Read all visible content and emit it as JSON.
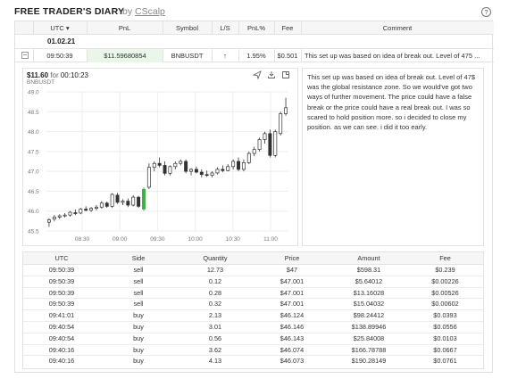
{
  "app": {
    "title": "FREE TRADER'S DIARY",
    "by": "by",
    "brand": "CScalp",
    "help_symbol": "?"
  },
  "trades_table": {
    "headers": [
      "UTC ▾",
      "PnL",
      "Symbol",
      "L/S",
      "PnL%",
      "Fee",
      "Comment"
    ],
    "date_group": "01.02.21",
    "rows": [
      {
        "collapse_symbol": "−",
        "utc": "09:50:39",
        "pnl": "$11.59680854",
        "symbol": "BNBUSDT",
        "ls": "↑",
        "pnl_pct": "1.95%",
        "fee": "$0.501",
        "comment": "This set up was based on idea of break out. Level of 475 ..."
      }
    ]
  },
  "chart_panel": {
    "price": "$11.60",
    "for_label": "for",
    "duration": "00:10:23",
    "symbol": "BNBUSDT",
    "tools": [
      "send-icon",
      "download-icon",
      "expand-icon"
    ]
  },
  "chart_data": {
    "type": "candlestick",
    "x_ticks": [
      "08:30",
      "09:00",
      "09:30",
      "10:00",
      "10:30",
      "11:00"
    ],
    "y_ticks": [
      45.5,
      46.0,
      46.5,
      47.0,
      47.5,
      48.0,
      48.5,
      49.0
    ],
    "ylim": [
      45.5,
      49.0
    ],
    "candles": [
      {
        "o": 45.72,
        "h": 45.82,
        "l": 45.6,
        "c": 45.78
      },
      {
        "o": 45.8,
        "h": 45.9,
        "l": 45.74,
        "c": 45.85
      },
      {
        "o": 45.85,
        "h": 45.92,
        "l": 45.8,
        "c": 45.88
      },
      {
        "o": 45.88,
        "h": 45.95,
        "l": 45.84,
        "c": 45.9
      },
      {
        "o": 45.9,
        "h": 46.0,
        "l": 45.86,
        "c": 45.97
      },
      {
        "o": 45.96,
        "h": 46.04,
        "l": 45.9,
        "c": 45.95
      },
      {
        "o": 45.95,
        "h": 46.08,
        "l": 45.92,
        "c": 46.05
      },
      {
        "o": 46.05,
        "h": 46.12,
        "l": 46.0,
        "c": 46.02
      },
      {
        "o": 46.02,
        "h": 46.1,
        "l": 45.98,
        "c": 46.07
      },
      {
        "o": 46.07,
        "h": 46.15,
        "l": 46.02,
        "c": 46.1
      },
      {
        "o": 46.1,
        "h": 46.25,
        "l": 46.06,
        "c": 46.2
      },
      {
        "o": 46.2,
        "h": 46.24,
        "l": 46.08,
        "c": 46.12
      },
      {
        "o": 46.12,
        "h": 46.45,
        "l": 46.08,
        "c": 46.42
      },
      {
        "o": 46.4,
        "h": 46.46,
        "l": 46.18,
        "c": 46.22
      },
      {
        "o": 46.22,
        "h": 46.3,
        "l": 46.15,
        "c": 46.25
      },
      {
        "o": 46.25,
        "h": 46.32,
        "l": 46.1,
        "c": 46.15
      },
      {
        "o": 46.15,
        "h": 46.4,
        "l": 46.12,
        "c": 46.35
      },
      {
        "o": 46.35,
        "h": 46.38,
        "l": 46.08,
        "c": 46.12
      },
      {
        "o": 46.05,
        "h": 46.6,
        "l": 46.0,
        "c": 46.55
      },
      {
        "o": 46.6,
        "h": 47.2,
        "l": 46.55,
        "c": 47.1
      },
      {
        "o": 47.1,
        "h": 47.25,
        "l": 47.0,
        "c": 47.2
      },
      {
        "o": 47.2,
        "h": 47.35,
        "l": 47.1,
        "c": 47.15
      },
      {
        "o": 47.15,
        "h": 47.25,
        "l": 46.9,
        "c": 46.95
      },
      {
        "o": 46.95,
        "h": 47.15,
        "l": 46.9,
        "c": 47.12
      },
      {
        "o": 47.12,
        "h": 47.25,
        "l": 47.05,
        "c": 47.2
      },
      {
        "o": 47.2,
        "h": 47.3,
        "l": 47.15,
        "c": 47.25
      },
      {
        "o": 47.25,
        "h": 47.3,
        "l": 46.95,
        "c": 47.0
      },
      {
        "o": 47.0,
        "h": 47.08,
        "l": 46.9,
        "c": 47.05
      },
      {
        "o": 47.05,
        "h": 47.12,
        "l": 46.95,
        "c": 46.98
      },
      {
        "o": 46.98,
        "h": 47.05,
        "l": 46.85,
        "c": 46.92
      },
      {
        "o": 46.92,
        "h": 47.02,
        "l": 46.86,
        "c": 46.9
      },
      {
        "o": 46.9,
        "h": 47.0,
        "l": 46.85,
        "c": 46.96
      },
      {
        "o": 46.96,
        "h": 47.1,
        "l": 46.92,
        "c": 47.05
      },
      {
        "o": 47.05,
        "h": 47.15,
        "l": 46.98,
        "c": 47.02
      },
      {
        "o": 47.02,
        "h": 47.18,
        "l": 47.0,
        "c": 47.12
      },
      {
        "o": 47.12,
        "h": 47.3,
        "l": 47.05,
        "c": 47.25
      },
      {
        "o": 47.25,
        "h": 47.35,
        "l": 47.0,
        "c": 47.05
      },
      {
        "o": 47.05,
        "h": 47.3,
        "l": 47.0,
        "c": 47.22
      },
      {
        "o": 47.22,
        "h": 47.5,
        "l": 47.18,
        "c": 47.45
      },
      {
        "o": 47.45,
        "h": 47.62,
        "l": 47.38,
        "c": 47.55
      },
      {
        "o": 47.55,
        "h": 47.85,
        "l": 47.5,
        "c": 47.8
      },
      {
        "o": 47.8,
        "h": 48.0,
        "l": 47.7,
        "c": 47.95
      },
      {
        "o": 47.95,
        "h": 48.05,
        "l": 47.35,
        "c": 47.4
      },
      {
        "o": 47.4,
        "h": 48.05,
        "l": 47.35,
        "c": 48.0
      },
      {
        "o": 47.95,
        "h": 48.5,
        "l": 47.9,
        "c": 48.45
      },
      {
        "o": 48.45,
        "h": 48.85,
        "l": 48.4,
        "c": 48.6
      }
    ],
    "marker_index": 18
  },
  "comment_text": "This set up was based on idea of break out. Level of 47$ was the global resistance zone. So we would've got two ways of further movement. The price could have a false break or the price could have a real break out. I was so scared to hold position more. so i decided to close my position. as we can see. i did it too early.",
  "executions": {
    "headers": [
      "UTC",
      "Side",
      "Quantity",
      "Price",
      "Amount",
      "Fee"
    ],
    "rows": [
      [
        "09:50:39",
        "sell",
        "12.73",
        "$47",
        "$598.31",
        "$0.239"
      ],
      [
        "09:50:39",
        "sell",
        "0.12",
        "$47.001",
        "$5.64012",
        "$0.00226"
      ],
      [
        "09:50:39",
        "sell",
        "0.28",
        "$47.001",
        "$13.16028",
        "$0.00526"
      ],
      [
        "09:50:39",
        "sell",
        "0.32",
        "$47.001",
        "$15.04032",
        "$0.00602"
      ],
      [
        "09:41:01",
        "buy",
        "2.13",
        "$46.124",
        "$98.24412",
        "$0.0393"
      ],
      [
        "09:40:54",
        "buy",
        "3.01",
        "$46.146",
        "$138.89946",
        "$0.0556"
      ],
      [
        "09:40:54",
        "buy",
        "0.56",
        "$46.143",
        "$25.84008",
        "$0.0103"
      ],
      [
        "09:40:16",
        "buy",
        "3.62",
        "$46.074",
        "$166.78788",
        "$0.0667"
      ],
      [
        "09:40:16",
        "buy",
        "4.13",
        "$46.073",
        "$190.28149",
        "$0.0761"
      ]
    ]
  },
  "colors": {
    "pnl_bg": "#e9f6e9",
    "candle_marker": "#3cb043",
    "grid": "#eeeeee"
  }
}
